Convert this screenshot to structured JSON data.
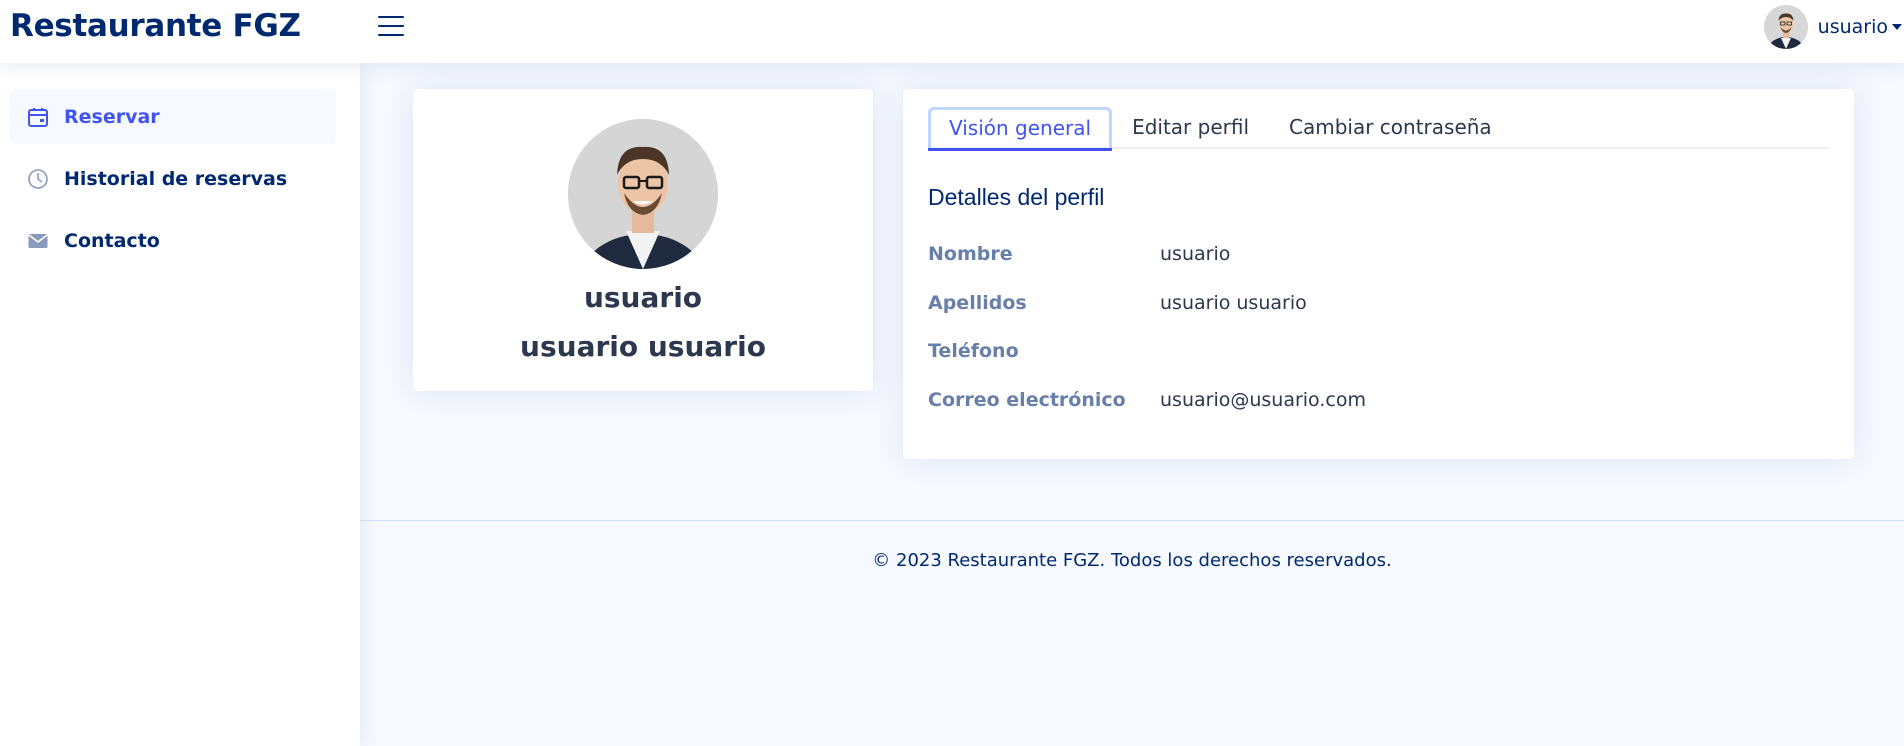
{
  "header": {
    "logo_text": "Restaurante FGZ",
    "user_label": "usuario"
  },
  "sidebar": {
    "items": [
      {
        "label": "Reservar",
        "icon": "calendar-icon",
        "active": true
      },
      {
        "label": "Historial de reservas",
        "icon": "clock-icon",
        "active": false
      },
      {
        "label": "Contacto",
        "icon": "envelope-icon",
        "active": false
      }
    ]
  },
  "profile_card": {
    "username": "usuario",
    "full_name": "usuario usuario"
  },
  "details": {
    "tabs": [
      {
        "label": "Visión general",
        "active": true
      },
      {
        "label": "Editar perfil",
        "active": false
      },
      {
        "label": "Cambiar contraseña",
        "active": false
      }
    ],
    "section_title": "Detalles del perfil",
    "fields": [
      {
        "label": "Nombre",
        "value": "usuario"
      },
      {
        "label": "Apellidos",
        "value": "usuario usuario"
      },
      {
        "label": "Teléfono",
        "value": ""
      },
      {
        "label": "Correo electrónico",
        "value": "usuario@usuario.com"
      }
    ]
  },
  "footer": {
    "text": "© 2023 Restaurante FGZ. Todos los derechos reservados."
  },
  "colors": {
    "primary": "#012970",
    "accent": "#4154f1",
    "background": "#f6f9ff",
    "text": "#2c384e"
  }
}
